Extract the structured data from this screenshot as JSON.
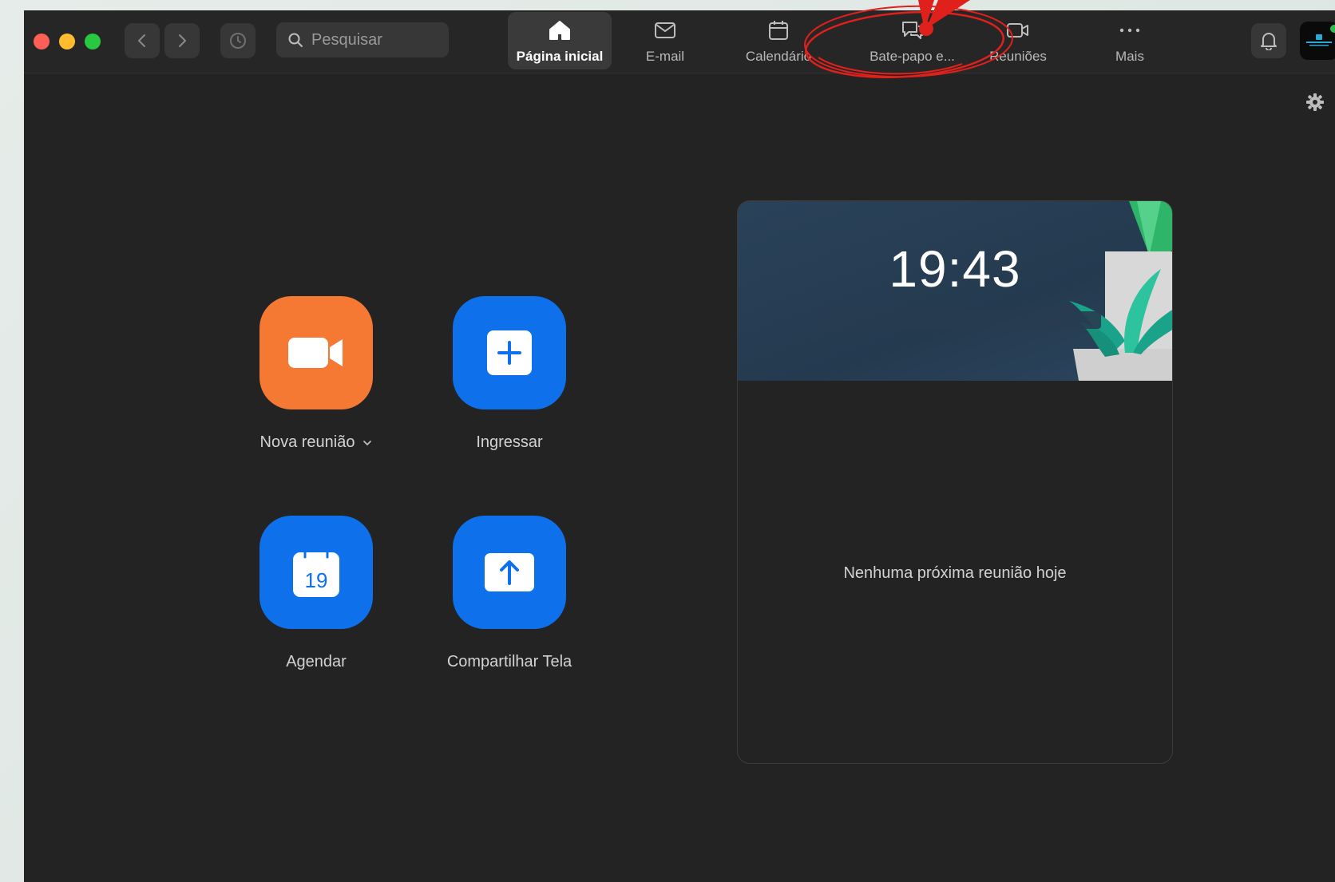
{
  "search": {
    "placeholder": "Pesquisar"
  },
  "tabs": [
    {
      "label": "Página inicial",
      "icon": "home-icon",
      "active": true
    },
    {
      "label": "E-mail",
      "icon": "mail-icon"
    },
    {
      "label": "Calendário",
      "icon": "calendar-icon"
    },
    {
      "label": "Bate-papo e...",
      "icon": "chat-icon"
    },
    {
      "label": "Reuniões",
      "icon": "video-icon"
    },
    {
      "label": "Mais",
      "icon": "more-icon"
    }
  ],
  "actions": {
    "new_meeting": {
      "label": "Nova reunião",
      "color": "#f57833"
    },
    "join": {
      "label": "Ingressar",
      "color": "#0e71eb"
    },
    "schedule": {
      "label": "Agendar",
      "calendar_day": "19",
      "color": "#0e71eb"
    },
    "share": {
      "label": "Compartilhar Tela",
      "color": "#0e71eb"
    }
  },
  "card": {
    "time": "19:43",
    "empty_message": "Nenhuma próxima reunião hoje"
  },
  "colors": {
    "window_bg": "#232323",
    "accent_blue": "#0e71eb",
    "accent_orange": "#f57833",
    "annotation_red": "#e0201b"
  }
}
